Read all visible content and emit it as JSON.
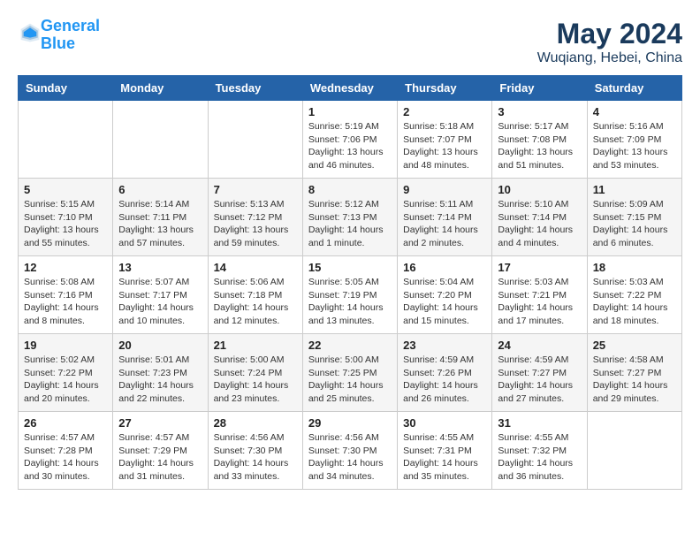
{
  "header": {
    "logo_line1": "General",
    "logo_line2": "Blue",
    "month": "May 2024",
    "location": "Wuqiang, Hebei, China"
  },
  "weekdays": [
    "Sunday",
    "Monday",
    "Tuesday",
    "Wednesday",
    "Thursday",
    "Friday",
    "Saturday"
  ],
  "weeks": [
    [
      {
        "day": "",
        "info": ""
      },
      {
        "day": "",
        "info": ""
      },
      {
        "day": "",
        "info": ""
      },
      {
        "day": "1",
        "info": "Sunrise: 5:19 AM\nSunset: 7:06 PM\nDaylight: 13 hours\nand 46 minutes."
      },
      {
        "day": "2",
        "info": "Sunrise: 5:18 AM\nSunset: 7:07 PM\nDaylight: 13 hours\nand 48 minutes."
      },
      {
        "day": "3",
        "info": "Sunrise: 5:17 AM\nSunset: 7:08 PM\nDaylight: 13 hours\nand 51 minutes."
      },
      {
        "day": "4",
        "info": "Sunrise: 5:16 AM\nSunset: 7:09 PM\nDaylight: 13 hours\nand 53 minutes."
      }
    ],
    [
      {
        "day": "5",
        "info": "Sunrise: 5:15 AM\nSunset: 7:10 PM\nDaylight: 13 hours\nand 55 minutes."
      },
      {
        "day": "6",
        "info": "Sunrise: 5:14 AM\nSunset: 7:11 PM\nDaylight: 13 hours\nand 57 minutes."
      },
      {
        "day": "7",
        "info": "Sunrise: 5:13 AM\nSunset: 7:12 PM\nDaylight: 13 hours\nand 59 minutes."
      },
      {
        "day": "8",
        "info": "Sunrise: 5:12 AM\nSunset: 7:13 PM\nDaylight: 14 hours\nand 1 minute."
      },
      {
        "day": "9",
        "info": "Sunrise: 5:11 AM\nSunset: 7:14 PM\nDaylight: 14 hours\nand 2 minutes."
      },
      {
        "day": "10",
        "info": "Sunrise: 5:10 AM\nSunset: 7:14 PM\nDaylight: 14 hours\nand 4 minutes."
      },
      {
        "day": "11",
        "info": "Sunrise: 5:09 AM\nSunset: 7:15 PM\nDaylight: 14 hours\nand 6 minutes."
      }
    ],
    [
      {
        "day": "12",
        "info": "Sunrise: 5:08 AM\nSunset: 7:16 PM\nDaylight: 14 hours\nand 8 minutes."
      },
      {
        "day": "13",
        "info": "Sunrise: 5:07 AM\nSunset: 7:17 PM\nDaylight: 14 hours\nand 10 minutes."
      },
      {
        "day": "14",
        "info": "Sunrise: 5:06 AM\nSunset: 7:18 PM\nDaylight: 14 hours\nand 12 minutes."
      },
      {
        "day": "15",
        "info": "Sunrise: 5:05 AM\nSunset: 7:19 PM\nDaylight: 14 hours\nand 13 minutes."
      },
      {
        "day": "16",
        "info": "Sunrise: 5:04 AM\nSunset: 7:20 PM\nDaylight: 14 hours\nand 15 minutes."
      },
      {
        "day": "17",
        "info": "Sunrise: 5:03 AM\nSunset: 7:21 PM\nDaylight: 14 hours\nand 17 minutes."
      },
      {
        "day": "18",
        "info": "Sunrise: 5:03 AM\nSunset: 7:22 PM\nDaylight: 14 hours\nand 18 minutes."
      }
    ],
    [
      {
        "day": "19",
        "info": "Sunrise: 5:02 AM\nSunset: 7:22 PM\nDaylight: 14 hours\nand 20 minutes."
      },
      {
        "day": "20",
        "info": "Sunrise: 5:01 AM\nSunset: 7:23 PM\nDaylight: 14 hours\nand 22 minutes."
      },
      {
        "day": "21",
        "info": "Sunrise: 5:00 AM\nSunset: 7:24 PM\nDaylight: 14 hours\nand 23 minutes."
      },
      {
        "day": "22",
        "info": "Sunrise: 5:00 AM\nSunset: 7:25 PM\nDaylight: 14 hours\nand 25 minutes."
      },
      {
        "day": "23",
        "info": "Sunrise: 4:59 AM\nSunset: 7:26 PM\nDaylight: 14 hours\nand 26 minutes."
      },
      {
        "day": "24",
        "info": "Sunrise: 4:59 AM\nSunset: 7:27 PM\nDaylight: 14 hours\nand 27 minutes."
      },
      {
        "day": "25",
        "info": "Sunrise: 4:58 AM\nSunset: 7:27 PM\nDaylight: 14 hours\nand 29 minutes."
      }
    ],
    [
      {
        "day": "26",
        "info": "Sunrise: 4:57 AM\nSunset: 7:28 PM\nDaylight: 14 hours\nand 30 minutes."
      },
      {
        "day": "27",
        "info": "Sunrise: 4:57 AM\nSunset: 7:29 PM\nDaylight: 14 hours\nand 31 minutes."
      },
      {
        "day": "28",
        "info": "Sunrise: 4:56 AM\nSunset: 7:30 PM\nDaylight: 14 hours\nand 33 minutes."
      },
      {
        "day": "29",
        "info": "Sunrise: 4:56 AM\nSunset: 7:30 PM\nDaylight: 14 hours\nand 34 minutes."
      },
      {
        "day": "30",
        "info": "Sunrise: 4:55 AM\nSunset: 7:31 PM\nDaylight: 14 hours\nand 35 minutes."
      },
      {
        "day": "31",
        "info": "Sunrise: 4:55 AM\nSunset: 7:32 PM\nDaylight: 14 hours\nand 36 minutes."
      },
      {
        "day": "",
        "info": ""
      }
    ]
  ]
}
